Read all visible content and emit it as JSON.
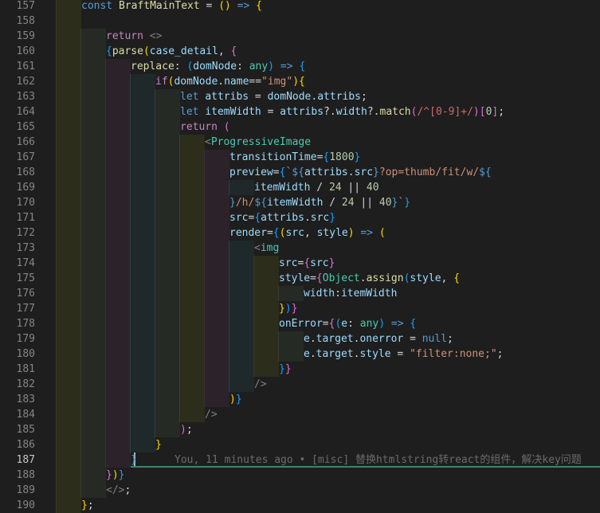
{
  "editor": {
    "active_line": "187",
    "blame": "You, 11 minutes ago • [misc] 替换htmlstring转react的组件，解决key问题",
    "lines": [
      {
        "n": "157",
        "guides": [
          1
        ],
        "tokens": [
          [
            "kw",
            "const "
          ],
          [
            "fn",
            "BraftMainText"
          ],
          [
            "op",
            " = "
          ],
          [
            "b1",
            "()"
          ],
          [
            "op",
            " "
          ],
          [
            "kw",
            "=>"
          ],
          [
            "op",
            " "
          ],
          [
            "b1",
            "{"
          ]
        ]
      },
      {
        "n": "158",
        "guides": [
          1
        ],
        "tokens": []
      },
      {
        "n": "159",
        "guides": [
          1,
          2
        ],
        "tokens": [
          [
            "ctl",
            "return "
          ],
          [
            "ang",
            "<>"
          ]
        ]
      },
      {
        "n": "160",
        "guides": [
          1,
          2
        ],
        "tokens": [
          [
            "b3",
            "{"
          ],
          [
            "fn",
            "parse"
          ],
          [
            "b1",
            "("
          ],
          [
            "var",
            "case_detail"
          ],
          [
            "op",
            ", "
          ],
          [
            "b2",
            "{"
          ]
        ]
      },
      {
        "n": "161",
        "guides": [
          1,
          2,
          3
        ],
        "tokens": [
          [
            "fn",
            "replace"
          ],
          [
            "op",
            ": "
          ],
          [
            "b3",
            "("
          ],
          [
            "var",
            "domNode"
          ],
          [
            "op",
            ": "
          ],
          [
            "type",
            "any"
          ],
          [
            "b3",
            ")"
          ],
          [
            "op",
            " "
          ],
          [
            "kw",
            "=>"
          ],
          [
            "op",
            " "
          ],
          [
            "b3",
            "{"
          ]
        ]
      },
      {
        "n": "162",
        "guides": [
          1,
          2,
          3,
          4
        ],
        "tokens": [
          [
            "ctl",
            "if"
          ],
          [
            "b1",
            "("
          ],
          [
            "var",
            "domNode"
          ],
          [
            "op",
            "."
          ],
          [
            "var",
            "name"
          ],
          [
            "op",
            "=="
          ],
          [
            "str",
            "\"img\""
          ],
          [
            "b1",
            ")"
          ],
          [
            "b1",
            "{"
          ]
        ]
      },
      {
        "n": "163",
        "guides": [
          1,
          2,
          3,
          4,
          2
        ],
        "tokens": [
          [
            "kw",
            "let "
          ],
          [
            "var",
            "attribs"
          ],
          [
            "op",
            " = "
          ],
          [
            "var",
            "domNode"
          ],
          [
            "op",
            "."
          ],
          [
            "var",
            "attribs"
          ],
          [
            "op",
            ";"
          ]
        ]
      },
      {
        "n": "164",
        "guides": [
          1,
          2,
          3,
          4,
          2
        ],
        "tokens": [
          [
            "kw",
            "let "
          ],
          [
            "var",
            "itemWidth"
          ],
          [
            "op",
            " = "
          ],
          [
            "var",
            "attribs"
          ],
          [
            "op",
            "?."
          ],
          [
            "var",
            "width"
          ],
          [
            "op",
            "?."
          ],
          [
            "fn",
            "match"
          ],
          [
            "b2",
            "("
          ],
          [
            "reg",
            "/^[0-9]+/"
          ],
          [
            "b2",
            ")"
          ],
          [
            "b2",
            "["
          ],
          [
            "num",
            "0"
          ],
          [
            "b2",
            "]"
          ],
          [
            "op",
            ";"
          ]
        ]
      },
      {
        "n": "165",
        "guides": [
          1,
          2,
          3,
          4,
          2
        ],
        "tokens": [
          [
            "ctl",
            "return "
          ],
          [
            "b2",
            "("
          ]
        ]
      },
      {
        "n": "166",
        "guides": [
          1,
          2,
          3,
          4,
          2,
          1
        ],
        "tokens": [
          [
            "ang",
            "<"
          ],
          [
            "tag",
            "ProgressiveImage"
          ]
        ]
      },
      {
        "n": "167",
        "guides": [
          1,
          2,
          3,
          4,
          2,
          1,
          3
        ],
        "tokens": [
          [
            "attr",
            "transitionTime"
          ],
          [
            "op",
            "="
          ],
          [
            "b3",
            "{"
          ],
          [
            "num",
            "1800"
          ],
          [
            "b3",
            "}"
          ]
        ]
      },
      {
        "n": "168",
        "guides": [
          1,
          2,
          3,
          4,
          2,
          1,
          3
        ],
        "tokens": [
          [
            "attr",
            "preview"
          ],
          [
            "op",
            "="
          ],
          [
            "b3",
            "{"
          ],
          [
            "str",
            "`"
          ],
          [
            "kw",
            "${"
          ],
          [
            "var",
            "attribs"
          ],
          [
            "op",
            "."
          ],
          [
            "var",
            "src"
          ],
          [
            "kw",
            "}"
          ],
          [
            "str",
            "?op=thumb/fit/w/"
          ],
          [
            "kw",
            "${"
          ]
        ]
      },
      {
        "n": "169",
        "guides": [
          1,
          2,
          3,
          4,
          2,
          1,
          3,
          4
        ],
        "tokens": [
          [
            "var",
            "itemWidth"
          ],
          [
            "op",
            " / "
          ],
          [
            "num",
            "24"
          ],
          [
            "op",
            " || "
          ],
          [
            "num",
            "40"
          ]
        ]
      },
      {
        "n": "170",
        "guides": [
          1,
          2,
          3,
          4,
          2,
          1,
          3
        ],
        "tokens": [
          [
            "kw",
            "}"
          ],
          [
            "str",
            "/h/"
          ],
          [
            "kw",
            "${"
          ],
          [
            "var",
            "itemWidth"
          ],
          [
            "op",
            " / "
          ],
          [
            "num",
            "24"
          ],
          [
            "op",
            " || "
          ],
          [
            "num",
            "40"
          ],
          [
            "kw",
            "}"
          ],
          [
            "str",
            "`"
          ],
          [
            "b3",
            "}"
          ]
        ]
      },
      {
        "n": "171",
        "guides": [
          1,
          2,
          3,
          4,
          2,
          1,
          3
        ],
        "tokens": [
          [
            "attr",
            "src"
          ],
          [
            "op",
            "="
          ],
          [
            "b3",
            "{"
          ],
          [
            "var",
            "attribs"
          ],
          [
            "op",
            "."
          ],
          [
            "var",
            "src"
          ],
          [
            "b3",
            "}"
          ]
        ]
      },
      {
        "n": "172",
        "guides": [
          1,
          2,
          3,
          4,
          2,
          1,
          3
        ],
        "tokens": [
          [
            "attr",
            "render"
          ],
          [
            "op",
            "="
          ],
          [
            "b3",
            "{"
          ],
          [
            "b1",
            "("
          ],
          [
            "var",
            "src"
          ],
          [
            "op",
            ", "
          ],
          [
            "var",
            "style"
          ],
          [
            "b1",
            ")"
          ],
          [
            "op",
            " "
          ],
          [
            "kw",
            "=>"
          ],
          [
            "op",
            " "
          ],
          [
            "b1",
            "("
          ]
        ]
      },
      {
        "n": "173",
        "guides": [
          1,
          2,
          3,
          4,
          2,
          1,
          3,
          4
        ],
        "tokens": [
          [
            "ang",
            "<"
          ],
          [
            "tag",
            "img"
          ]
        ]
      },
      {
        "n": "174",
        "guides": [
          1,
          2,
          3,
          4,
          2,
          1,
          3,
          4,
          1
        ],
        "tokens": [
          [
            "attr",
            "src"
          ],
          [
            "op",
            "="
          ],
          [
            "b2",
            "{"
          ],
          [
            "var",
            "src"
          ],
          [
            "b2",
            "}"
          ]
        ]
      },
      {
        "n": "175",
        "guides": [
          1,
          2,
          3,
          4,
          2,
          1,
          3,
          4,
          1
        ],
        "tokens": [
          [
            "attr",
            "style"
          ],
          [
            "op",
            "="
          ],
          [
            "b2",
            "{"
          ],
          [
            "type",
            "Object"
          ],
          [
            "op",
            "."
          ],
          [
            "fn",
            "assign"
          ],
          [
            "b3",
            "("
          ],
          [
            "var",
            "style"
          ],
          [
            "op",
            ", "
          ],
          [
            "b1",
            "{"
          ]
        ]
      },
      {
        "n": "176",
        "guides": [
          1,
          2,
          3,
          4,
          2,
          1,
          3,
          4,
          1,
          2
        ],
        "tokens": [
          [
            "var",
            "width"
          ],
          [
            "op",
            ":"
          ],
          [
            "var",
            "itemWidth"
          ]
        ]
      },
      {
        "n": "177",
        "guides": [
          1,
          2,
          3,
          4,
          2,
          1,
          3,
          4,
          1
        ],
        "tokens": [
          [
            "b1",
            "}"
          ],
          [
            "b3",
            ")"
          ],
          [
            "b2",
            "}"
          ]
        ]
      },
      {
        "n": "178",
        "guides": [
          1,
          2,
          3,
          4,
          2,
          1,
          3,
          4,
          1
        ],
        "tokens": [
          [
            "attr",
            "onError"
          ],
          [
            "op",
            "="
          ],
          [
            "b2",
            "{"
          ],
          [
            "b3",
            "("
          ],
          [
            "var",
            "e"
          ],
          [
            "op",
            ": "
          ],
          [
            "type",
            "any"
          ],
          [
            "b3",
            ")"
          ],
          [
            "op",
            " "
          ],
          [
            "kw",
            "=>"
          ],
          [
            "op",
            " "
          ],
          [
            "b3",
            "{"
          ]
        ]
      },
      {
        "n": "179",
        "guides": [
          1,
          2,
          3,
          4,
          2,
          1,
          3,
          4,
          1,
          2
        ],
        "tokens": [
          [
            "var",
            "e"
          ],
          [
            "op",
            "."
          ],
          [
            "var",
            "target"
          ],
          [
            "op",
            "."
          ],
          [
            "var",
            "onerror"
          ],
          [
            "op",
            " = "
          ],
          [
            "kw",
            "null"
          ],
          [
            "op",
            ";"
          ]
        ]
      },
      {
        "n": "180",
        "guides": [
          1,
          2,
          3,
          4,
          2,
          1,
          3,
          4,
          1,
          2
        ],
        "tokens": [
          [
            "var",
            "e"
          ],
          [
            "op",
            "."
          ],
          [
            "var",
            "target"
          ],
          [
            "op",
            "."
          ],
          [
            "var",
            "style"
          ],
          [
            "op",
            " = "
          ],
          [
            "str",
            "\"filter:none;\""
          ],
          [
            "op",
            ";"
          ]
        ]
      },
      {
        "n": "181",
        "guides": [
          1,
          2,
          3,
          4,
          2,
          1,
          3,
          4,
          1
        ],
        "tokens": [
          [
            "b3",
            "}"
          ],
          [
            "b2",
            "}"
          ]
        ]
      },
      {
        "n": "182",
        "guides": [
          1,
          2,
          3,
          4,
          2,
          1,
          3,
          4
        ],
        "tokens": [
          [
            "ang",
            "/>"
          ]
        ]
      },
      {
        "n": "183",
        "guides": [
          1,
          2,
          3,
          4,
          2,
          1,
          3
        ],
        "tokens": [
          [
            "b1",
            ")"
          ],
          [
            "b3",
            "}"
          ]
        ]
      },
      {
        "n": "184",
        "guides": [
          1,
          2,
          3,
          4,
          2,
          1
        ],
        "tokens": [
          [
            "ang",
            "/>"
          ]
        ]
      },
      {
        "n": "185",
        "guides": [
          1,
          2,
          3,
          4,
          2
        ],
        "tokens": [
          [
            "b2",
            ")"
          ],
          [
            "op",
            ";"
          ]
        ]
      },
      {
        "n": "186",
        "guides": [
          1,
          2,
          3,
          4
        ],
        "tokens": [
          [
            "b1",
            "}"
          ]
        ]
      },
      {
        "n": "187",
        "guides": [
          1,
          2,
          3
        ],
        "tokens": [
          [
            "b3",
            "}"
          ]
        ]
      },
      {
        "n": "188",
        "guides": [
          1,
          2
        ],
        "tokens": [
          [
            "b2",
            "}"
          ],
          [
            "b1",
            ")"
          ],
          [
            "b3",
            "}"
          ]
        ]
      },
      {
        "n": "189",
        "guides": [
          1,
          2
        ],
        "tokens": [
          [
            "ang",
            "</>"
          ],
          [
            "op",
            ";"
          ]
        ]
      },
      {
        "n": "190",
        "guides": [
          1
        ],
        "tokens": [
          [
            "b1",
            "}"
          ],
          [
            "op",
            ";"
          ]
        ]
      }
    ]
  }
}
